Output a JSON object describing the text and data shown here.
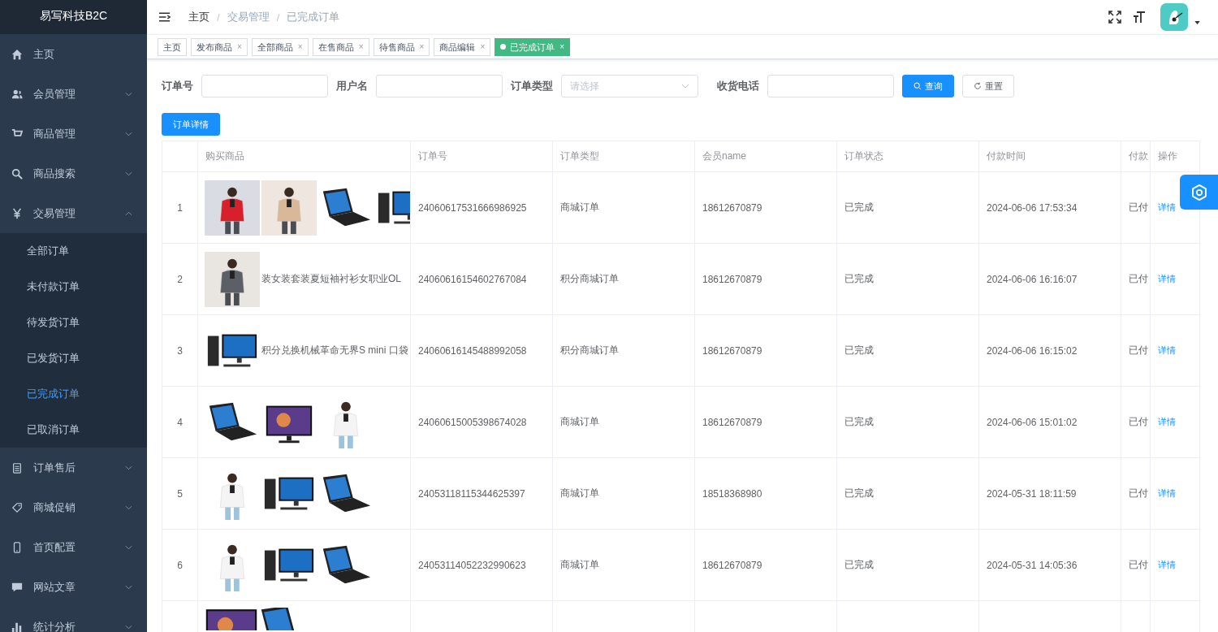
{
  "sidebar": {
    "title": "易写科技B2C",
    "items": [
      {
        "label": "主页",
        "kind": "link"
      },
      {
        "label": "会员管理",
        "kind": "group",
        "expanded": false
      },
      {
        "label": "商品管理",
        "kind": "group",
        "expanded": false
      },
      {
        "label": "商品搜索",
        "kind": "group",
        "expanded": false
      },
      {
        "label": "交易管理",
        "kind": "group",
        "expanded": true,
        "children": [
          {
            "label": "全部订单",
            "selected": false
          },
          {
            "label": "未付款订单",
            "selected": false
          },
          {
            "label": "待发货订单",
            "selected": false
          },
          {
            "label": "已发货订单",
            "selected": false
          },
          {
            "label": "已完成订单",
            "selected": true
          },
          {
            "label": "已取消订单",
            "selected": false
          }
        ]
      },
      {
        "label": "订单售后",
        "kind": "group",
        "expanded": false
      },
      {
        "label": "商城促销",
        "kind": "group",
        "expanded": false
      },
      {
        "label": "首页配置",
        "kind": "group",
        "expanded": false
      },
      {
        "label": "网站文章",
        "kind": "group",
        "expanded": false
      },
      {
        "label": "统计分析",
        "kind": "group",
        "expanded": false
      }
    ]
  },
  "breadcrumb": {
    "separator": "/",
    "items": [
      "主页",
      "交易管理",
      "已完成订单"
    ]
  },
  "tags": [
    {
      "label": "主页",
      "selected": false
    },
    {
      "label": "发布商品",
      "close": "×",
      "selected": false
    },
    {
      "label": "全部商品",
      "close": "×",
      "selected": false
    },
    {
      "label": "在售商品",
      "close": "×",
      "selected": false
    },
    {
      "label": "待售商品",
      "close": "×",
      "selected": false
    },
    {
      "label": "商品编辑",
      "close": "×",
      "selected": false
    },
    {
      "label": "已完成订单",
      "close": "×",
      "selected": true
    }
  ],
  "filters": [
    {
      "label": "订单号",
      "kind": "input"
    },
    {
      "label": "用户名",
      "kind": "input"
    },
    {
      "label": "订单类型",
      "kind": "select",
      "placeholder": "请选择"
    },
    {
      "label": "收货电话",
      "kind": "input"
    }
  ],
  "filter_buttons": [
    {
      "label": "查询",
      "kind": "primary"
    },
    {
      "label": "重置",
      "kind": "default"
    }
  ],
  "detail_button": "订单详情",
  "table": {
    "columns": [
      "购买商品",
      "订单号",
      "订单类型",
      "会员name",
      "订单状态",
      "付款时间",
      "付款",
      "操作"
    ],
    "rows": [
      {
        "index": "1",
        "products": [
          {
            "kind": "picture"
          },
          {
            "kind": "picture"
          },
          {
            "kind": "picture"
          },
          {
            "kind": "picture"
          }
        ],
        "order_no": "24060617531666986925",
        "order_type": "商城订单",
        "member": "18612670879",
        "status": "已完成",
        "paid_time": "2024-06-06 17:53:34",
        "pay_status": "已付",
        "action": "详情"
      },
      {
        "index": "2",
        "products": [
          {
            "kind": "picture"
          }
        ],
        "product_name": "装女装套装夏短袖衬衫女职业OL",
        "order_no": "24060616154602767084",
        "order_type": "积分商城订单",
        "member": "18612670879",
        "status": "已完成",
        "paid_time": "2024-06-06 16:16:07",
        "pay_status": "已付",
        "action": "详情"
      },
      {
        "index": "3",
        "products": [
          {
            "kind": "picture"
          }
        ],
        "product_name": "积分兑换机械革命无界S mini 口袋",
        "order_no": "24060616145488992058",
        "order_type": "积分商城订单",
        "member": "18612670879",
        "status": "已完成",
        "paid_time": "2024-06-06 16:15:02",
        "pay_status": "已付",
        "action": "详情"
      },
      {
        "index": "4",
        "products": [
          {
            "kind": "picture"
          },
          {
            "kind": "picture"
          },
          {
            "kind": "picture"
          }
        ],
        "order_no": "24060615005398674028",
        "order_type": "商城订单",
        "member": "18612670879",
        "status": "已完成",
        "paid_time": "2024-06-06 15:01:02",
        "pay_status": "已付",
        "action": "详情"
      },
      {
        "index": "5",
        "products": [
          {
            "kind": "picture"
          },
          {
            "kind": "picture"
          },
          {
            "kind": "picture"
          }
        ],
        "order_no": "24053118115344625397",
        "order_type": "商城订单",
        "member": "18518368980",
        "status": "已完成",
        "paid_time": "2024-05-31 18:11:59",
        "pay_status": "已付",
        "action": "详情"
      },
      {
        "index": "6",
        "products": [
          {
            "kind": "picture"
          },
          {
            "kind": "picture"
          },
          {
            "kind": "picture"
          }
        ],
        "order_no": "24053114052232990623",
        "order_type": "商城订单",
        "member": "18612670879",
        "status": "已完成",
        "paid_time": "2024-05-31 14:05:36",
        "pay_status": "已付",
        "action": "详情"
      },
      {
        "products": [
          {
            "kind": "picture"
          },
          {
            "kind": "picture"
          }
        ]
      }
    ]
  }
}
